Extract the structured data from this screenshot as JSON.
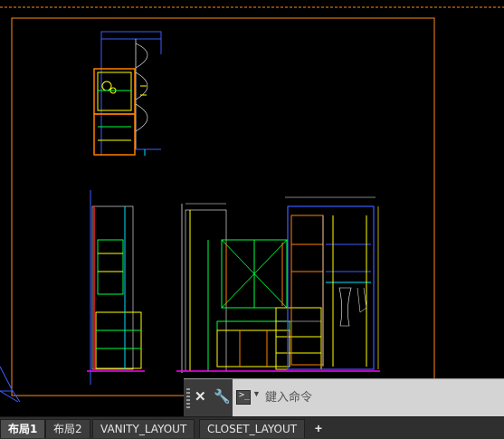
{
  "command_line": {
    "close_icon": "close-icon",
    "settings_icon": "wrench-icon",
    "prompt_icon": "command-prompt-icon",
    "placeholder": "鍵入命令",
    "prompt_glyph": ">_"
  },
  "layout_tabs": [
    {
      "label": "布局1",
      "active": true
    },
    {
      "label": "布局2",
      "active": false
    },
    {
      "label": "VANITY_LAYOUT",
      "active": false
    },
    {
      "label": "CLOSET_LAYOUT",
      "active": false
    }
  ],
  "add_tab_label": "+",
  "colors": {
    "background": "#000000",
    "paper_border": "#ff8c1a",
    "viewport_border": "#ff8c1a",
    "cyan": "#00e5ff",
    "yellow": "#ffff00",
    "green": "#00ff40",
    "orange": "#ff7f00",
    "magenta": "#ff00ff",
    "blue": "#3c5cff"
  }
}
